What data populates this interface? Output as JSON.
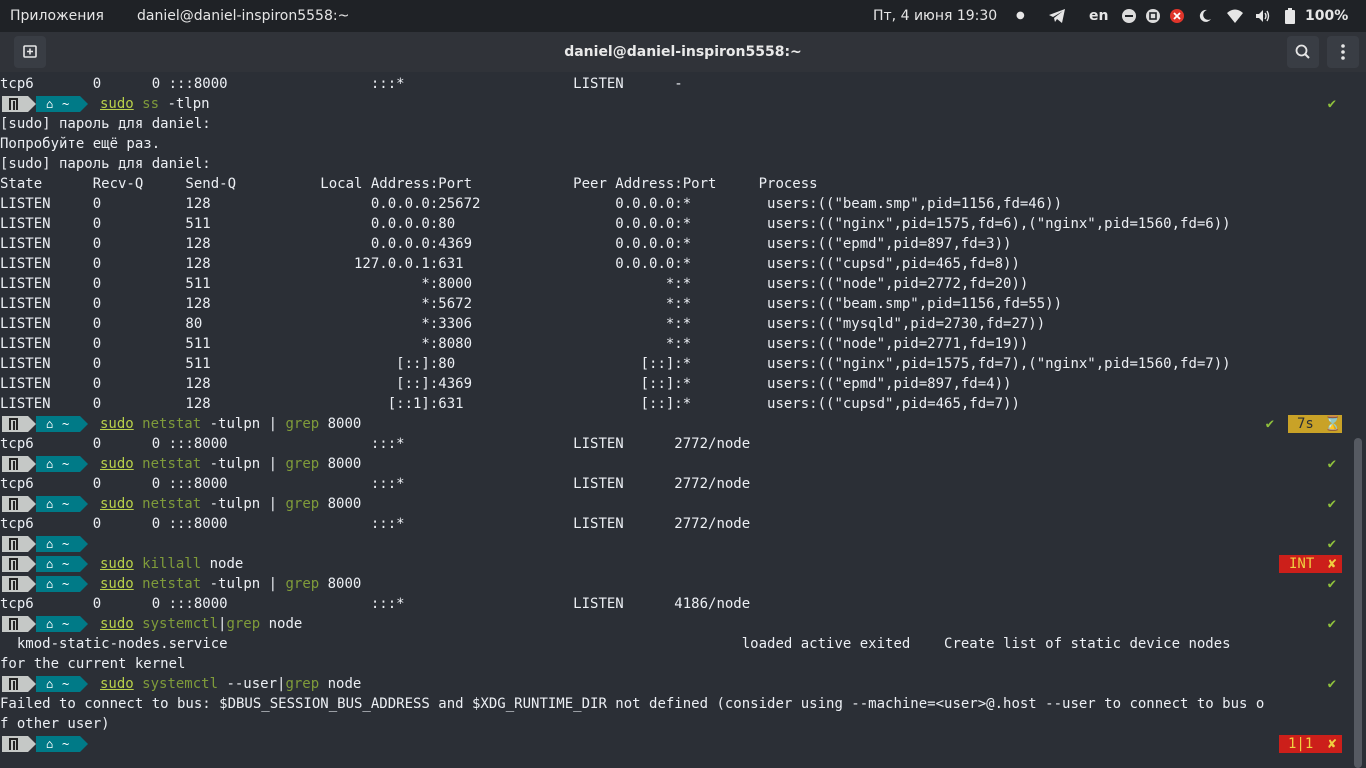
{
  "topbar": {
    "apps_label": "Приложения",
    "window_name": "daniel@daniel-inspiron5558:~",
    "datetime": "Пт, 4 июня  19:30",
    "lang": "en",
    "battery": "100%"
  },
  "titlebar": {
    "title": "daniel@daniel-inspiron5558:~"
  },
  "prompt": {
    "home": "~"
  },
  "terminal": {
    "l0": "tcp6       0      0 :::8000                 :::*                    LISTEN      -",
    "c1_sudo": "sudo",
    "c1_sp": " ",
    "c1_cmd": "ss",
    "c1_rest": " -tlpn",
    "l2": "[sudo] пароль для daniel:",
    "l3": "Попробуйте ещё раз.",
    "l4": "[sudo] пароль для daniel:",
    "l5": "State      Recv-Q     Send-Q          Local Address:Port            Peer Address:Port     Process",
    "l6": "LISTEN     0          128                   0.0.0.0:25672                0.0.0.0:*         users:((\"beam.smp\",pid=1156,fd=46))",
    "l7": "LISTEN     0          511                   0.0.0.0:80                   0.0.0.0:*         users:((\"nginx\",pid=1575,fd=6),(\"nginx\",pid=1560,fd=6))",
    "l8": "LISTEN     0          128                   0.0.0.0:4369                 0.0.0.0:*         users:((\"epmd\",pid=897,fd=3))",
    "l9": "LISTEN     0          128                 127.0.0.1:631                  0.0.0.0:*         users:((\"cupsd\",pid=465,fd=8))",
    "l10": "LISTEN     0          511                         *:8000                       *:*         users:((\"node\",pid=2772,fd=20))",
    "l11": "LISTEN     0          128                         *:5672                       *:*         users:((\"beam.smp\",pid=1156,fd=55))",
    "l12": "LISTEN     0          80                          *:3306                       *:*         users:((\"mysqld\",pid=2730,fd=27))",
    "l13": "LISTEN     0          511                         *:8080                       *:*         users:((\"node\",pid=2771,fd=19))",
    "l14": "LISTEN     0          511                      [::]:80                      [::]:*         users:((\"nginx\",pid=1575,fd=7),(\"nginx\",pid=1560,fd=7))",
    "l15": "LISTEN     0          128                      [::]:4369                    [::]:*         users:((\"epmd\",pid=897,fd=4))",
    "l16": "LISTEN     0          128                     [::1]:631                     [::]:*         users:((\"cupsd\",pid=465,fd=7))",
    "c17_sudo": "sudo",
    "c17_a": "netstat",
    "c17_b": " -tulpn | ",
    "c17_c": "grep",
    "c17_d": " 8000",
    "l18": "tcp6       0      0 :::8000                 :::*                    LISTEN      2772/node",
    "c19_sudo": "sudo",
    "c19_a": "netstat",
    "c19_b": " -tulpn | ",
    "c19_c": "grep",
    "c19_d": " 8000",
    "l20": "tcp6       0      0 :::8000                 :::*                    LISTEN      2772/node",
    "c21_sudo": "sudo",
    "c21_a": "netstat",
    "c21_b": " -tulpn | ",
    "c21_c": "grep",
    "c21_d": " 8000",
    "l22": "tcp6       0      0 :::8000                 :::*                    LISTEN      2772/node",
    "c24_sudo": "sudo",
    "c24_a": "killall",
    "c24_b": " node",
    "c25_sudo": "sudo",
    "c25_a": "netstat",
    "c25_b": " -tulpn | ",
    "c25_c": "grep",
    "c25_d": " 8000",
    "l26": "tcp6       0      0 :::8000                 :::*                    LISTEN      4186/node",
    "c27_sudo": "sudo",
    "c27_a": "systemctl",
    "c27_b": "|",
    "c27_c": "grep",
    "c27_d": " node",
    "l28": "  kmod-static-nodes.service                                                             loaded active exited    Create list of static device nodes",
    "l29": "for the current kernel",
    "c30_sudo": "sudo",
    "c30_a": "systemctl",
    "c30_b": " --user|",
    "c30_c": "grep",
    "c30_d": " node",
    "l31": "Failed to connect to bus: $DBUS_SESSION_BUS_ADDRESS and $XDG_RUNTIME_DIR not defined (consider using --machine=<user>@.host --user to connect to bus o",
    "l32": "f other user)"
  },
  "status": {
    "ok": "✔",
    "fail": "✘",
    "time": "7s",
    "hourglass": "⌛",
    "int_label": "INT",
    "jobs": "1|1"
  },
  "colors": {
    "bg": "#2b2f36",
    "topbar": "#1f2226",
    "prompt_os": "#c5c8c6",
    "prompt_dir": "#007a87",
    "ok": "#8fc03c",
    "error": "#cc1f1a",
    "time_badge": "#c9a227"
  },
  "icons": [
    "telegram-icon",
    "minimize-icon",
    "maximize-icon",
    "close-icon",
    "moon-icon",
    "wifi-icon",
    "volume-icon",
    "battery-icon",
    "new-tab-icon",
    "search-icon",
    "menu-icon",
    "home-icon",
    "manjaro-icon"
  ]
}
